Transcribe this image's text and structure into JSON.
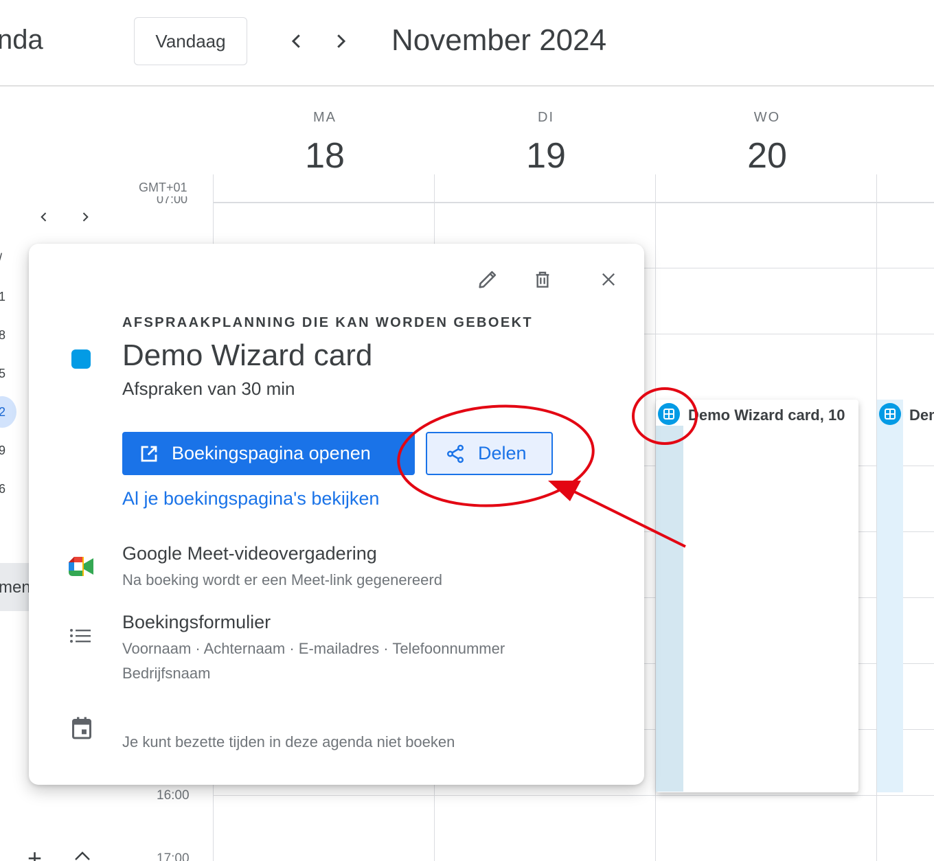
{
  "header": {
    "app_title": "nda",
    "today_label": "Vandaag",
    "month_title": "November 2024"
  },
  "days": [
    {
      "name": "MA",
      "num": "18"
    },
    {
      "name": "DI",
      "num": "19"
    },
    {
      "name": "WO",
      "num": "20"
    }
  ],
  "timezone": "GMT+01",
  "time_labels": {
    "top_cut": "07:00",
    "t1600": "16:00",
    "t1700": "17:00"
  },
  "mini_calendar": {
    "days": [
      "/",
      "1",
      "8",
      "5",
      "2",
      "9",
      "6"
    ],
    "side_label": "men"
  },
  "events": [
    {
      "title": "Demo Wizard card, 10",
      "color": "#039be5"
    },
    {
      "title": "Demo",
      "color": "#039be5"
    }
  ],
  "popup": {
    "eyebrow": "AFSPRAAKPLANNING DIE KAN WORDEN GEBOEKT",
    "title": "Demo Wizard card",
    "subtitle": "Afspraken van 30 min",
    "color": "#039be5",
    "open_button": "Boekingspagina openen",
    "share_button": "Delen",
    "all_pages_link": "Al je boekingspagina's bekijken",
    "meet": {
      "title": "Google Meet-videovergadering",
      "subtitle": "Na boeking wordt er een Meet-link gegenereerd"
    },
    "form": {
      "title": "Boekingsformulier",
      "fields_line1": "Voornaam · Achternaam · E-mailadres · Telefoonnummer",
      "fields_line2": "Bedrijfsnaam"
    },
    "calendar_note": "Je kunt bezette tijden in deze agenda niet boeken"
  },
  "colors": {
    "accent": "#1a73e8",
    "annotation": "#e30613"
  }
}
